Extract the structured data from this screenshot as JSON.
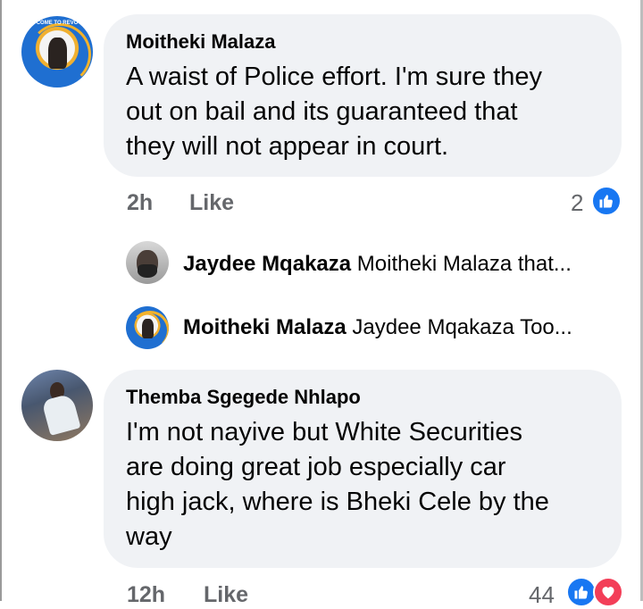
{
  "comments": [
    {
      "author": "Moitheki Malaza",
      "text_lines": [
        "A waist of Police effort. I'm sure they",
        "out on bail and its guaranteed that",
        "they will not appear in court."
      ],
      "time": "2h",
      "like_label": "Like",
      "reaction_count": "2",
      "reactions": [
        "like-icon"
      ],
      "avatar_text": "COME TO REVO"
    },
    {
      "author": "Themba Sgegede Nhlapo",
      "text_lines": [
        "I'm not nayive but White Securities",
        "are doing great job especially car",
        "high jack, where is Bheki Cele by the",
        "way"
      ],
      "time": "12h",
      "like_label": "Like",
      "reaction_count": "44",
      "reactions": [
        "like-icon",
        "love-icon"
      ]
    }
  ],
  "replies": [
    {
      "author": "Jaydee Mqakaza",
      "preview": "Moitheki Malaza that..."
    },
    {
      "author": "Moitheki Malaza",
      "preview": "Jaydee Mqakaza Too..."
    }
  ],
  "colors": {
    "bubble": "#f0f2f5",
    "like_blue": "#1877f2",
    "love_red": "#f33e58",
    "meta_gray": "#65676b"
  }
}
